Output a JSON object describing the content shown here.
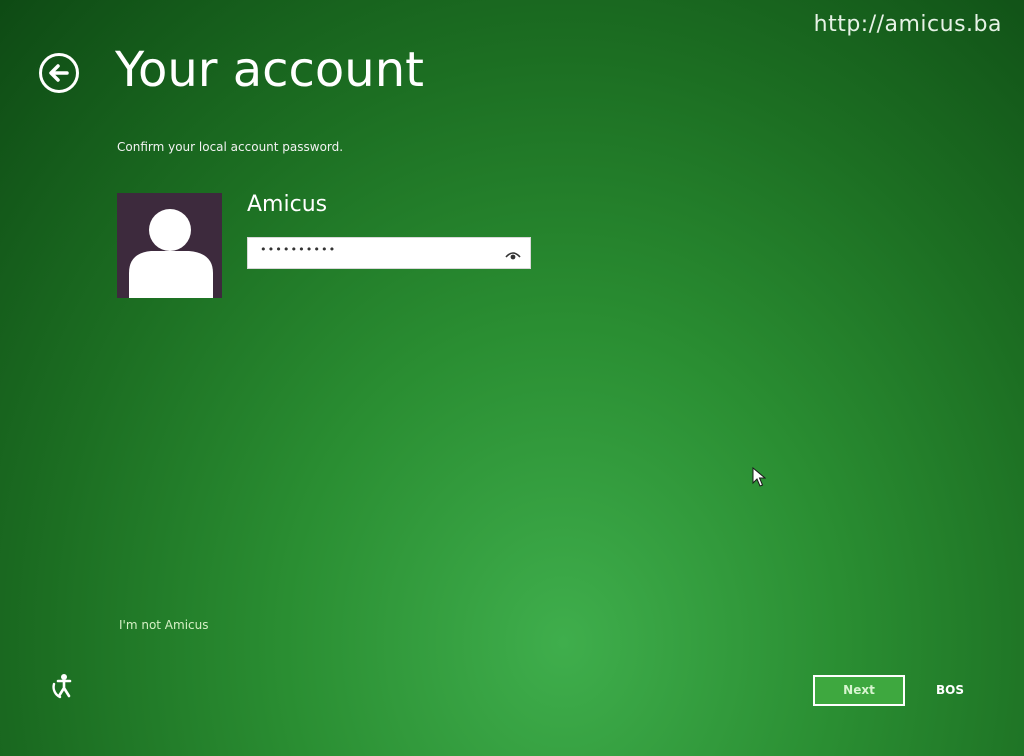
{
  "watermark": "http://amicus.ba",
  "header": {
    "title": "Your account",
    "back_icon": "back-arrow-circle-icon"
  },
  "subtitle": "Confirm your local account password.",
  "account": {
    "avatar_icon": "user-silhouette-icon",
    "name": "Amicus",
    "password_mask": "••••••••••",
    "reveal_icon": "eye-icon"
  },
  "links": {
    "not_user": "I'm not Amicus"
  },
  "footer": {
    "ease_of_access_icon": "ease-of-access-icon",
    "next_label": "Next",
    "ime_label": "BOS"
  },
  "colors": {
    "background_dark": "#0e4a14",
    "background_light": "#3fae4c",
    "avatar_bg": "#3d2a3d",
    "next_button_bg": "#3ea83f"
  }
}
